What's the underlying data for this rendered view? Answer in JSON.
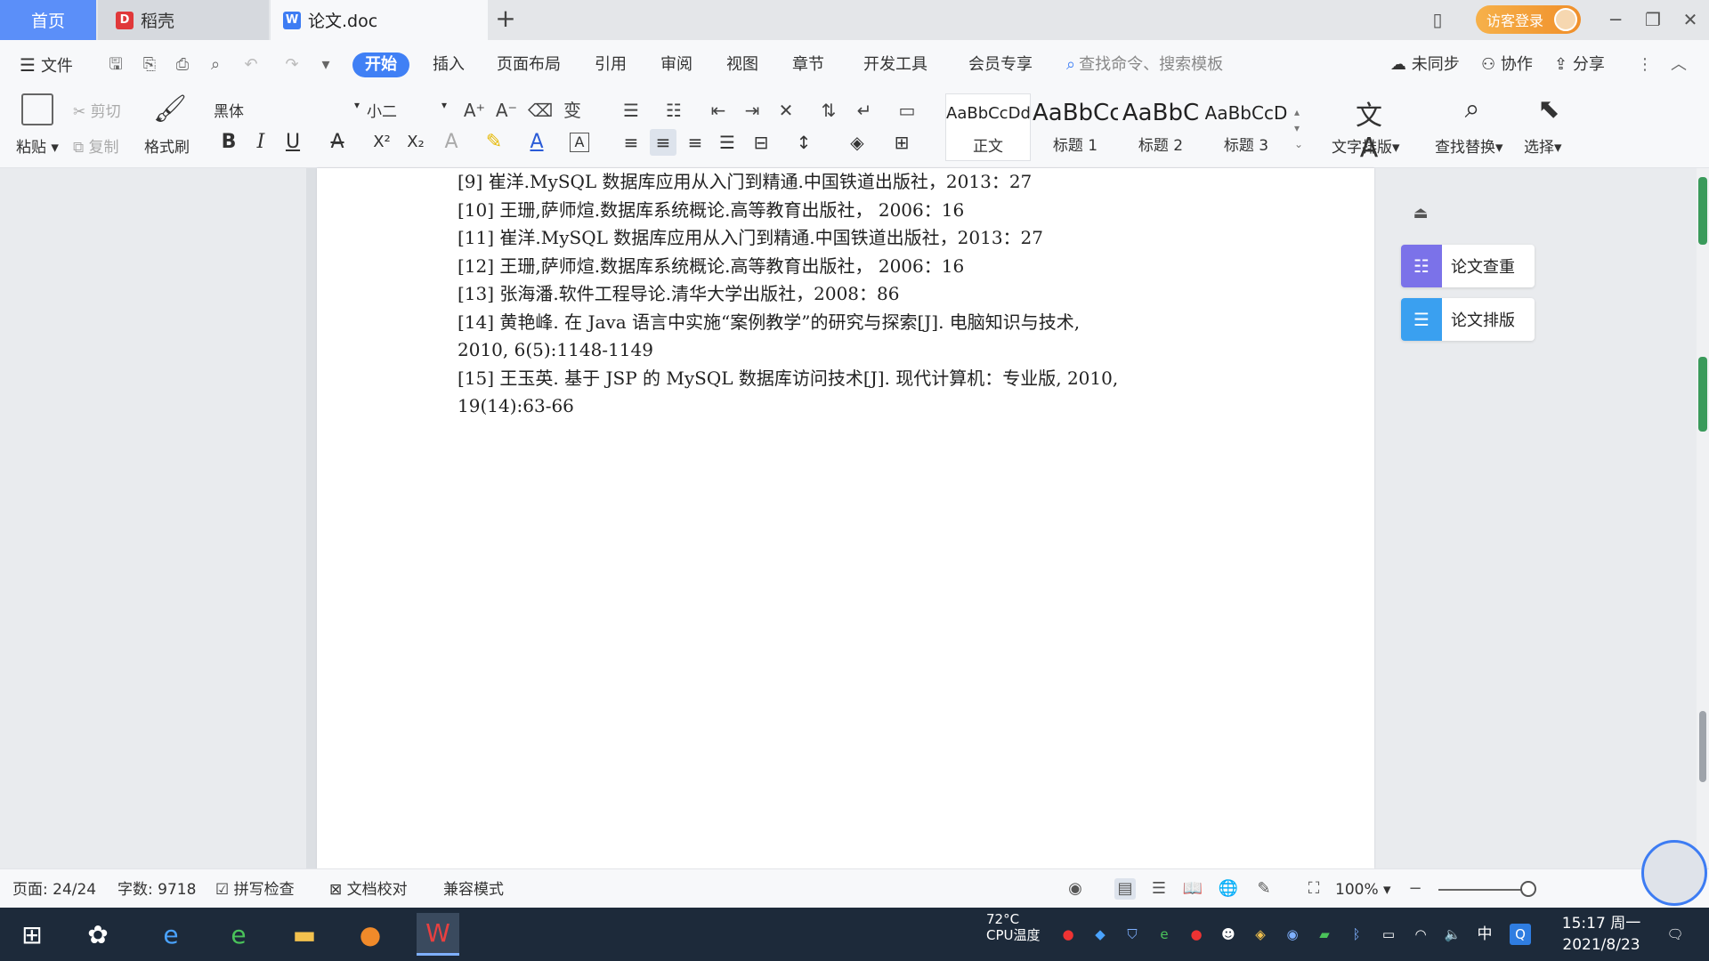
{
  "tabs": {
    "home": "首页",
    "daoke": "稻壳",
    "doc": "论文.doc"
  },
  "titlebar": {
    "login": "访客登录"
  },
  "menu": {
    "file": "文件",
    "items": [
      "开始",
      "插入",
      "页面布局",
      "引用",
      "审阅",
      "视图",
      "章节",
      "开发工具",
      "会员专享"
    ],
    "search_placeholder": "查找命令、搜索模板",
    "sync": "未同步",
    "collab": "协作",
    "share": "分享"
  },
  "ribbon": {
    "paste": "粘贴",
    "cut": "剪切",
    "copy": "复制",
    "format_painter": "格式刷",
    "font_name": "黑体",
    "font_size": "小二",
    "styles": [
      {
        "sample": "AaBbCcDd",
        "label": "正文"
      },
      {
        "sample": "AaBbCc",
        "label": "标题 1"
      },
      {
        "sample": "AaBbC",
        "label": "标题 2"
      },
      {
        "sample": "AaBbCcD",
        "label": "标题 3"
      }
    ],
    "text_layout": "文字排版",
    "find_replace": "查找替换",
    "select": "选择"
  },
  "references": [
    {
      "lines": [
        "[9]  崔洋.MySQL 数据库应用从入门到精通.中国铁道出版社，2013：27"
      ]
    },
    {
      "lines": [
        "[10]  王珊,萨师煊.数据库系统概论.高等教育出版社， 2006：16"
      ]
    },
    {
      "lines": [
        "[11]  崔洋.MySQL 数据库应用从入门到精通.中国铁道出版社，2013：27"
      ]
    },
    {
      "lines": [
        "[12]  王珊,萨师煊.数据库系统概论.高等教育出版社， 2006：16"
      ]
    },
    {
      "lines": [
        "[13]  张海潘.软件工程导论.清华大学出版社，2008：86"
      ]
    },
    {
      "lines": [
        "[14]  黄艳峰. 在 Java 语言中实施“案例教学”的研究与探索[J]. 电脑知识与技术,",
        "2010, 6(5):1148-1149"
      ]
    },
    {
      "lines": [
        "[15]  王玉英. 基于 JSP 的 MySQL 数据库访问技术[J]. 现代计算机：专业版, 2010,",
        "19(14):63-66"
      ]
    }
  ],
  "side_panel": {
    "check": "论文查重",
    "layout": "论文排版"
  },
  "status": {
    "page": "页面: 24/24",
    "words": "字数: 9718",
    "spell": "拼写检查",
    "proof": "文档校对",
    "compat": "兼容模式",
    "zoom": "100%"
  },
  "taskbar": {
    "cpu_temp": "72°C",
    "cpu_label": "CPU温度",
    "ime": "中",
    "time": "15:17 周一",
    "date": "2021/8/23"
  }
}
